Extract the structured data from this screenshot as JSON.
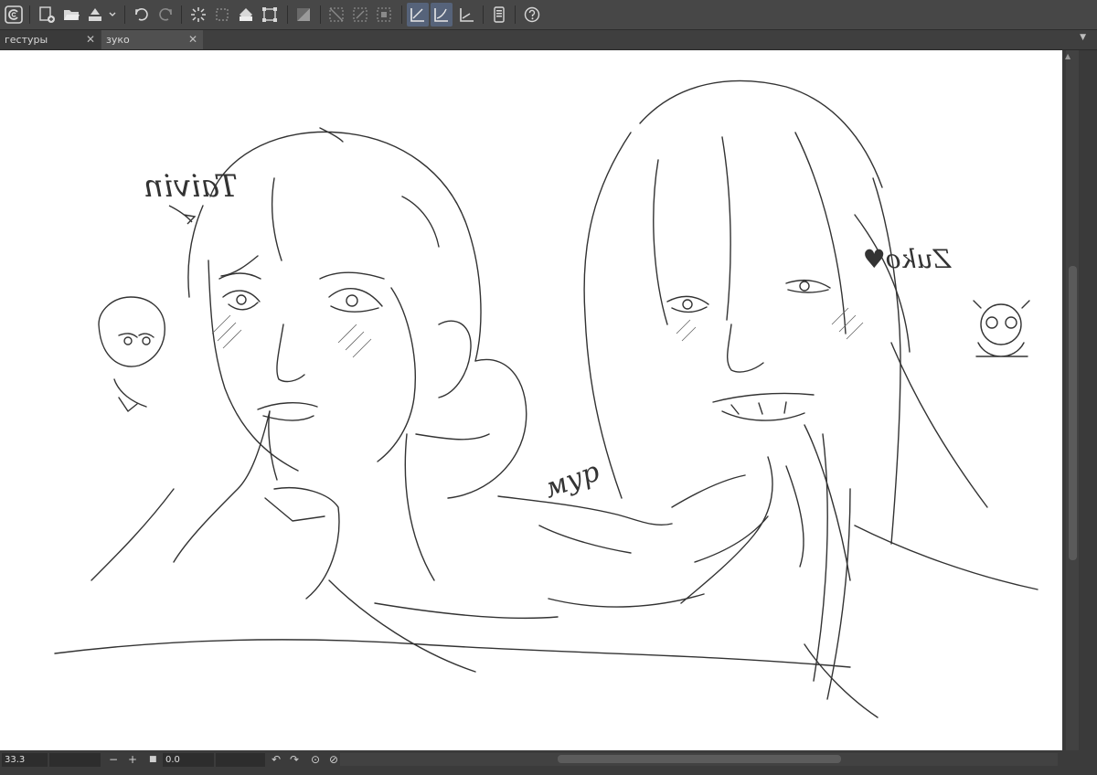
{
  "tabs": [
    {
      "label": "гестуры",
      "close": "✕",
      "active": false
    },
    {
      "label": "зуко",
      "close": "✕",
      "active": true
    }
  ],
  "toolbar_icons": [
    "clip-studio-icon",
    "new-file-icon",
    "open-folder-icon",
    "save-icon",
    "dropdown-icon",
    "undo-icon",
    "redo-icon",
    "loading-icon",
    "selection-icon",
    "fill-icon",
    "transform-icon",
    "layer-color-icon",
    "clear-selection-icon",
    "invert-selection-icon",
    "stop-selection-icon",
    "ruler-snap-icon",
    "ruler-edit-icon",
    "ruler-toggle-icon",
    "device-icon",
    "help-icon"
  ],
  "canvas_text": {
    "left_name": "Taivin",
    "right_name": "Zuko♥",
    "purr": "мур"
  },
  "status": {
    "zoom": "33.3",
    "minus": "−",
    "plus": "+",
    "rotation": "0.0"
  },
  "colors": {
    "toolbar_bg": "#474747",
    "active_tool": "#56637a",
    "canvas_bg": "#ffffff",
    "ink": "#333333"
  }
}
